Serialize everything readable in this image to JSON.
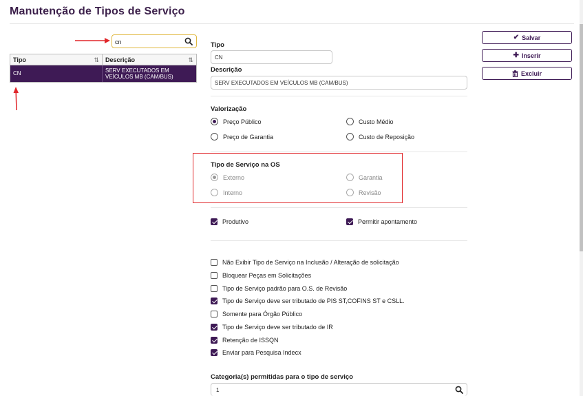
{
  "page": {
    "title": "Manutenção de Tipos de Serviço"
  },
  "search": {
    "value": "cn"
  },
  "grid": {
    "columns": [
      "Tipo",
      "Descrição"
    ],
    "sort_glyph": "⇅",
    "rows": [
      {
        "tipo": "CN",
        "descricao": "SERV EXECUTADOS EM VEÍCULOS MB (CAM/BUS)"
      }
    ]
  },
  "form": {
    "tipo_label": "Tipo",
    "tipo_value": "CN",
    "descricao_label": "Descrição",
    "descricao_value": "SERV EXECUTADOS EM VEÍCULOS MB (CAM/BUS)",
    "valorizacao": {
      "label": "Valorização",
      "options": [
        {
          "label": "Preço Público",
          "checked": true
        },
        {
          "label": "Custo Médio",
          "checked": false
        },
        {
          "label": "Preço de Garantia",
          "checked": false
        },
        {
          "label": "Custo de Reposição",
          "checked": false
        }
      ]
    },
    "tipo_os": {
      "label": "Tipo de Serviço na OS",
      "options": [
        {
          "label": "Externo",
          "checked": true
        },
        {
          "label": "Garantia",
          "checked": false
        },
        {
          "label": "Interno",
          "checked": false
        },
        {
          "label": "Revisão",
          "checked": false
        }
      ]
    },
    "flags": [
      {
        "label": "Produtivo",
        "checked": true
      },
      {
        "label": "Permitir apontamento",
        "checked": true
      }
    ],
    "options": [
      {
        "label": "Não Exibir Tipo de Serviço na Inclusão / Alteração de solicitação",
        "checked": false
      },
      {
        "label": "Bloquear Peças em Solicitações",
        "checked": false
      },
      {
        "label": "Tipo de Serviço padrão para O.S. de Revisão",
        "checked": false
      },
      {
        "label": "Tipo de Serviço deve ser tributado de PIS ST,COFINS ST e CSLL.",
        "checked": true
      },
      {
        "label": "Somente para Órgão Público",
        "checked": false
      },
      {
        "label": "Tipo de Serviço deve ser tributado de IR",
        "checked": true
      },
      {
        "label": "Retenção de ISSQN",
        "checked": true
      },
      {
        "label": "Enviar para Pesquisa Indecx",
        "checked": true
      }
    ],
    "categoria_label": "Categoria(s) permitidas para o tipo de serviço",
    "categoria_value": "1"
  },
  "toolbar": {
    "save_label": "Salvar",
    "insert_label": "Inserir",
    "delete_label": "Excluir"
  },
  "colors": {
    "primary": "#3e1a55",
    "highlight": "#e0262a",
    "search_border": "#e0b840"
  }
}
